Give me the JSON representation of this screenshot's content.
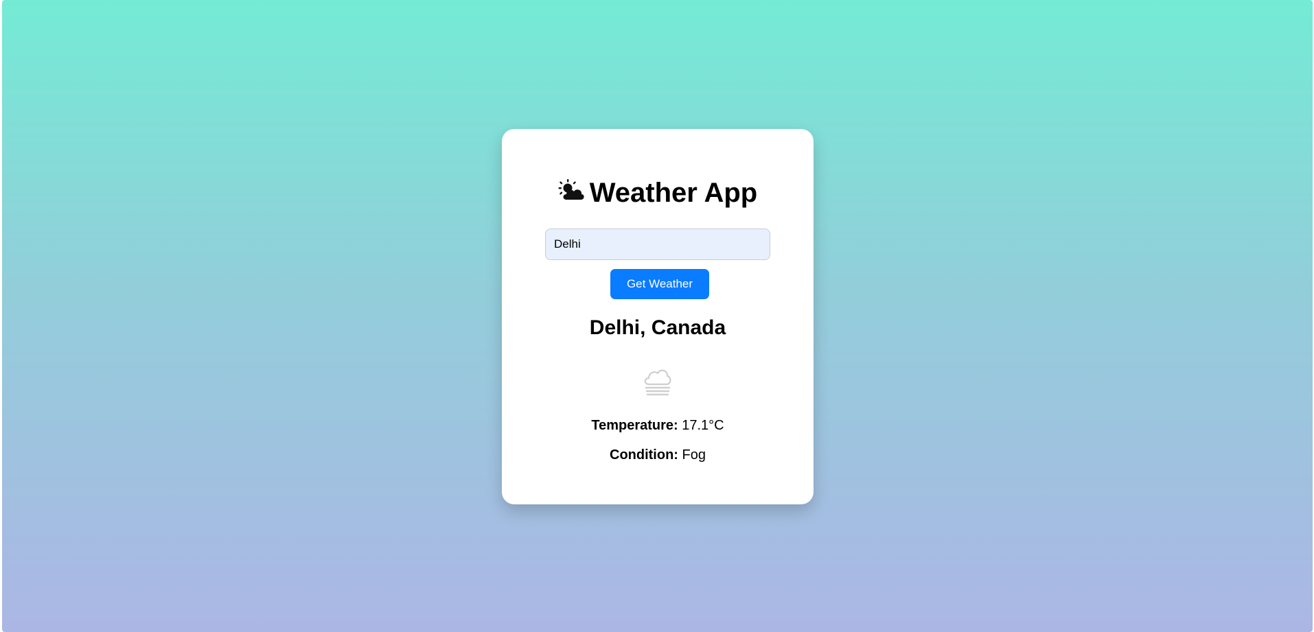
{
  "app": {
    "title": "Weather App",
    "title_icon": "sun-behind-cloud-icon"
  },
  "search": {
    "value": "Delhi",
    "button_label": "Get Weather"
  },
  "result": {
    "location": "Delhi, Canada",
    "icon": "fog-icon",
    "temperature_label": "Temperature:",
    "temperature_value": "17.1°C",
    "condition_label": "Condition:",
    "condition_value": "Fog"
  },
  "colors": {
    "gradient_top": "#74ebd5",
    "gradient_bottom": "#acb6e5",
    "button": "#0a7cff",
    "input_bg": "#e8f0fe",
    "card": "#ffffff"
  }
}
